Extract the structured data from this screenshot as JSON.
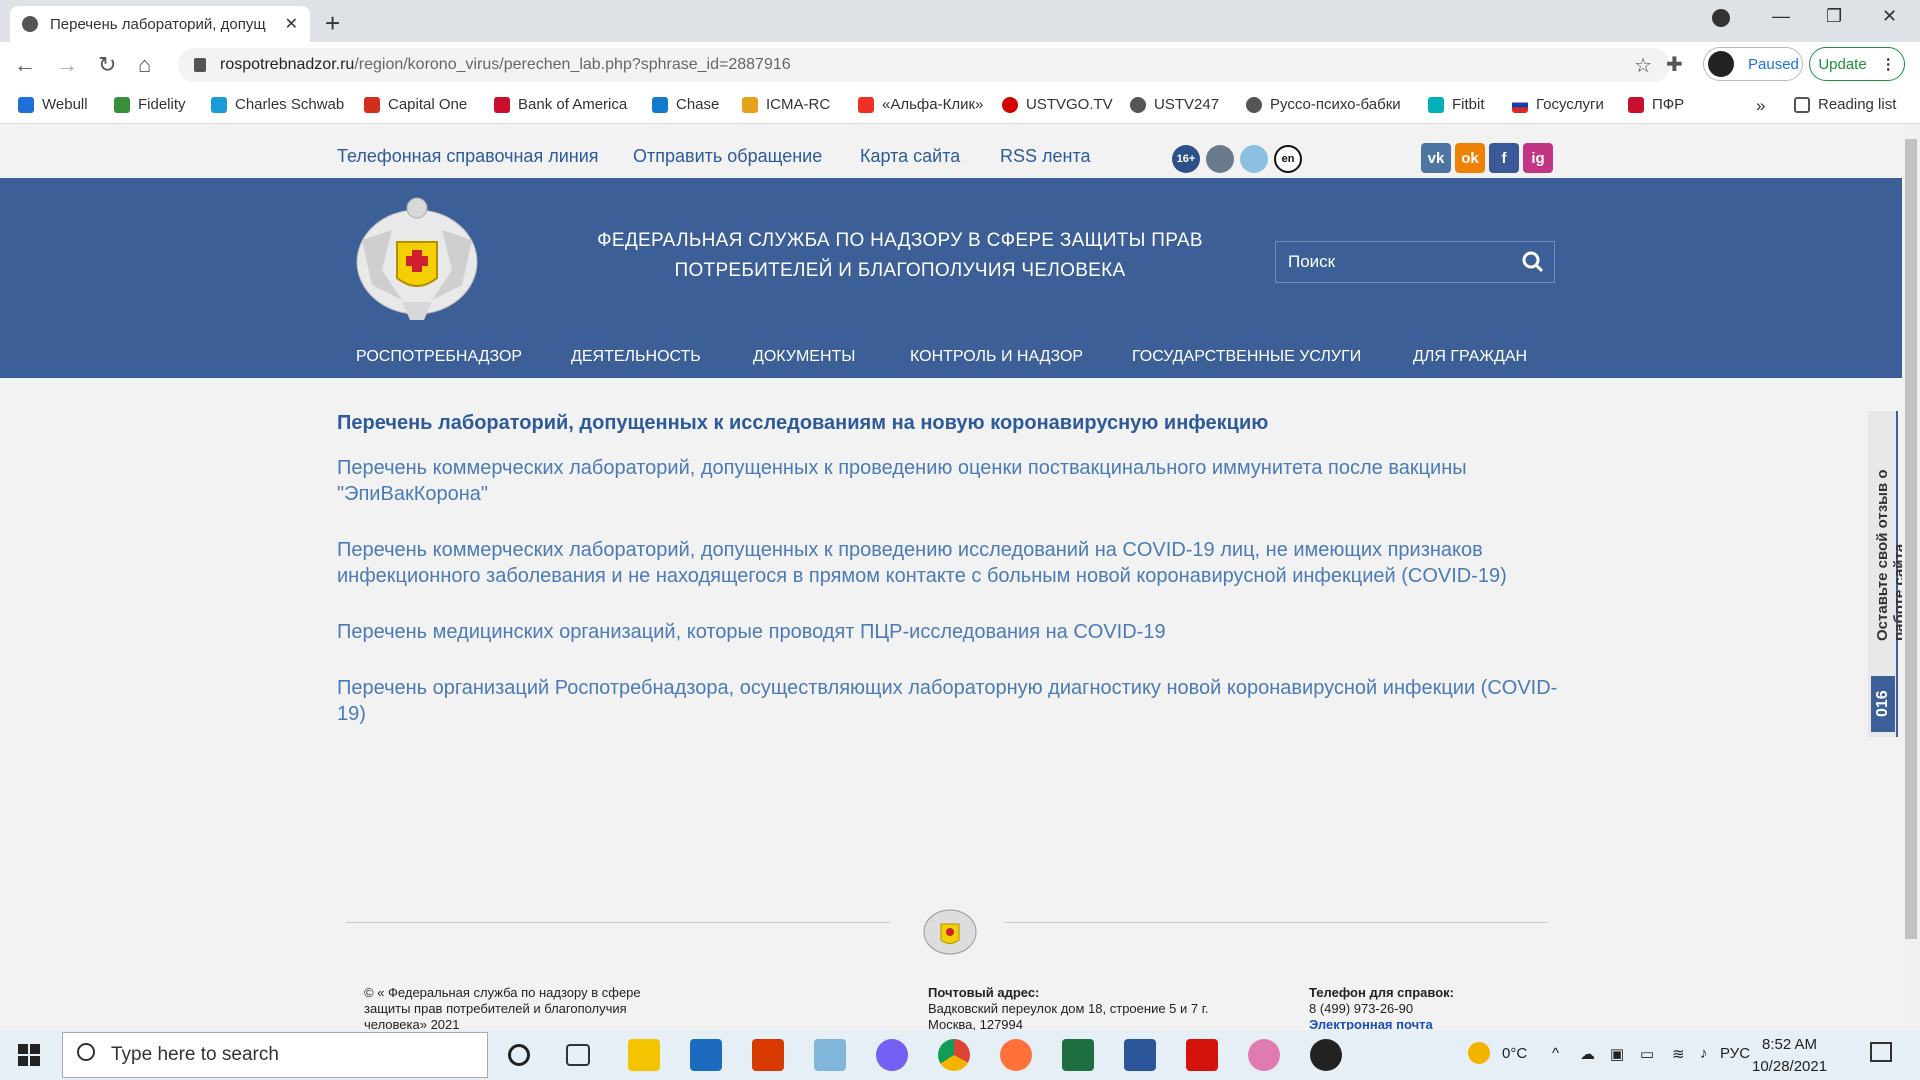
{
  "browser": {
    "tab_title": "Перечень лабораторий, допущ",
    "url_host": "rospotrebnadzor.ru",
    "url_path": "/region/korono_virus/perechen_lab.php?sphrase_id=2887916",
    "profile_label": "Paused",
    "update_label": "Update",
    "reading_list": "Reading list",
    "overflow": "»"
  },
  "bookmarks": [
    {
      "label": "Webull",
      "color": "#1e6fd9"
    },
    {
      "label": "Fidelity",
      "color": "#3a8f3a"
    },
    {
      "label": "Charles Schwab",
      "color": "#1a9ad6"
    },
    {
      "label": "Capital One",
      "color": "#d22e1e"
    },
    {
      "label": "Bank of America",
      "color": "#c8102e"
    },
    {
      "label": "Chase",
      "color": "#117aca"
    },
    {
      "label": "ICMA-RC",
      "color": "#e8a21a"
    },
    {
      "label": "«Альфа-Клик»",
      "color": "#ef3124"
    },
    {
      "label": "USTVGO.TV",
      "color": "#d40000"
    },
    {
      "label": "USTV247",
      "color": "#555555"
    },
    {
      "label": "Руссо-психо-бабки",
      "color": "#555555"
    },
    {
      "label": "Fitbit",
      "color": "#00b0b9"
    },
    {
      "label": "Госуслуги",
      "color": "#d52b1e"
    },
    {
      "label": "ПФР",
      "color": "#c8102e"
    }
  ],
  "topnav": {
    "hotline": "Телефонная справочная линия",
    "appeal": "Отправить обращение",
    "sitemap": "Карта сайта",
    "rss": "RSS лента",
    "age_badge": "16+",
    "lang_badge": "en"
  },
  "social": {
    "vk": "vk",
    "ok": "ok",
    "fb": "f",
    "ig": "ig"
  },
  "header": {
    "title_line1": "ФЕДЕРАЛЬНАЯ СЛУЖБА ПО НАДЗОРУ В СФЕРЕ ЗАЩИТЫ ПРАВ",
    "title_line2": "ПОТРЕБИТЕЛЕЙ И БЛАГОПОЛУЧИЯ ЧЕЛОВЕКА",
    "search_placeholder": "Поиск"
  },
  "menu": [
    "РОСПОТРЕБНАДЗОР",
    "ДЕЯТЕЛЬНОСТЬ",
    "ДОКУМЕНТЫ",
    "КОНТРОЛЬ И НАДЗОР",
    "ГОСУДАРСТВЕННЫЕ УСЛУГИ",
    "ДЛЯ ГРАЖДАН"
  ],
  "content": {
    "heading": "Перечень лабораторий, допущенных к исследованиям на новую коронавирусную инфекцию",
    "links": [
      "Перечень коммерческих лабораторий, допущенных к проведению оценки поствакцинального иммунитета после вакцины \"ЭпиВакКорона\"",
      "Перечень коммерческих лабораторий, допущенных к проведению исследований на COVID-19 лиц, не имеющих признаков инфекционного заболевания и не находящегося в прямом контакте с больным новой коронавирусной инфекцией (COVID-19)",
      "Перечень медицинских организаций, которые проводят ПЦР-исследования на COVID-19",
      "Перечень организаций Роспотребнадзора, осуществляющих лабораторную диагностику новой коронавирусной инфекции (COVID-19)"
    ]
  },
  "feedback": {
    "text": "Оставьте свой отзыв о работе сайта",
    "number": "016"
  },
  "footer": {
    "copyright": "© « Федеральная служба по надзору в сфере защиты прав потребителей и благополучия человека» 2021",
    "address_label": "Почтовый адрес:",
    "address": "Вадковский переулок дом 18, строение 5 и 7 г. Москва, 127994",
    "phone_label": "Телефон для справок:",
    "phone": "8 (499) 973-26-90",
    "email_label": "Электронная почта"
  },
  "taskbar": {
    "search_placeholder": "Type here to search",
    "temperature": "0°C",
    "lang": "РУС",
    "time": "8:52 AM",
    "date": "10/28/2021"
  }
}
